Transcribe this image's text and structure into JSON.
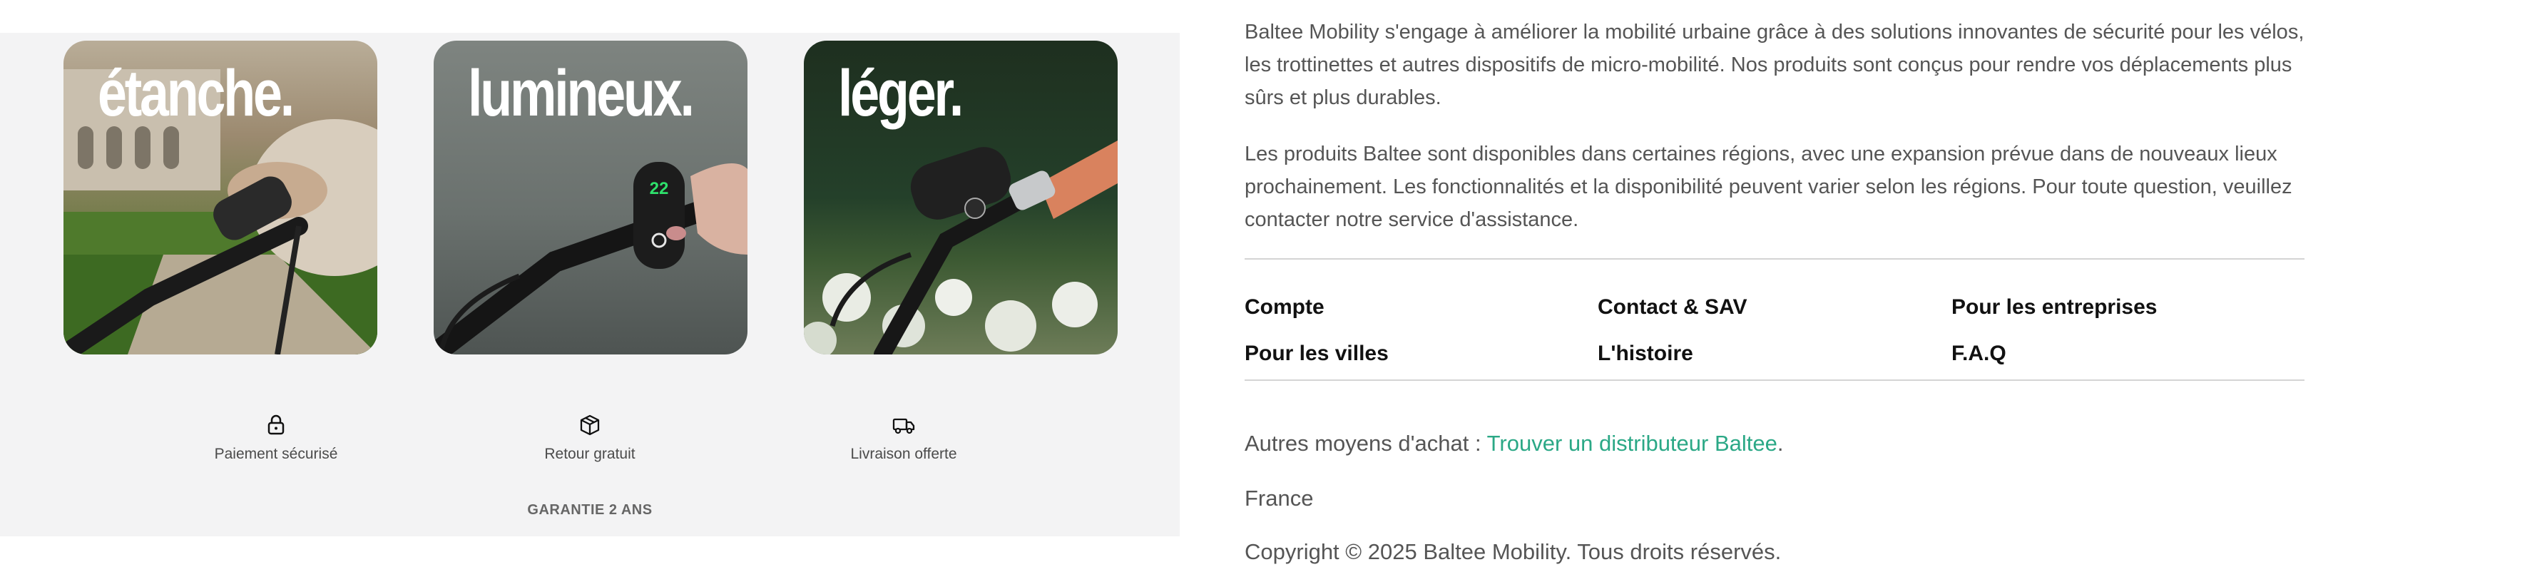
{
  "cards": [
    {
      "word": "étanche."
    },
    {
      "word": "lumineux."
    },
    {
      "word": "léger."
    }
  ],
  "features": [
    {
      "icon": "lock-icon",
      "label": "Paiement sécurisé"
    },
    {
      "icon": "box-icon",
      "label": "Retour gratuit"
    },
    {
      "icon": "truck-icon",
      "label": "Livraison offerte"
    }
  ],
  "guarantee": "GARANTIE 2 ANS",
  "about": {
    "paragraph1": "Baltee Mobility s'engage à améliorer la mobilité urbaine grâce à des solutions innovantes de sécurité pour les vélos, les trottinettes et autres dispositifs de micro-mobilité. Nos produits sont conçus pour rendre vos déplacements plus sûrs et plus durables.",
    "paragraph2": "Les produits Baltee sont disponibles dans certaines régions, avec une expansion prévue dans de nouveaux lieux prochainement. Les fonctionnalités et la disponibilité peuvent varier selon les régions. Pour toute question, veuillez contacter notre service d'assistance."
  },
  "footer_links": {
    "compte": "Compte",
    "contact": "Contact & SAV",
    "entreprises": "Pour les entreprises",
    "villes": "Pour les villes",
    "histoire": "L'histoire",
    "faq": "F.A.Q"
  },
  "other_purchase": {
    "prefix": "Autres moyens d'achat : ",
    "link": "Trouver un distributeur Baltee",
    "suffix": "."
  },
  "country": "France",
  "copyright": "Copyright © 2025 Baltee Mobility. Tous droits réservés.",
  "colors": {
    "accent_link": "#2ba886",
    "panel_bg": "#f3f3f4",
    "text": "#555555"
  }
}
